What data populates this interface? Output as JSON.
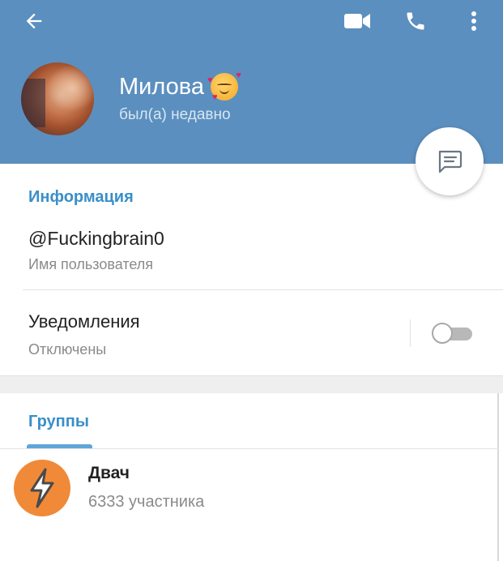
{
  "header": {
    "name": "Милова",
    "status": "был(а) недавно",
    "icons": [
      "back-arrow-icon",
      "video-call-icon",
      "phone-icon",
      "more-vert-icon"
    ],
    "background": "#5b8fbf"
  },
  "fab": {
    "icon": "message-icon"
  },
  "info": {
    "section_title": "Информация",
    "username": "@Fuckingbrain0",
    "username_label": "Имя пользователя",
    "notifications_label": "Уведомления",
    "notifications_status": "Отключены",
    "notifications_enabled": false
  },
  "groups": {
    "tab_label": "Группы",
    "items": [
      {
        "name": "Двач",
        "members": "6333 участника",
        "avatar_color": "#f08a38"
      }
    ]
  },
  "colors": {
    "accent": "#3a8fc8",
    "header": "#5b8fbf"
  }
}
